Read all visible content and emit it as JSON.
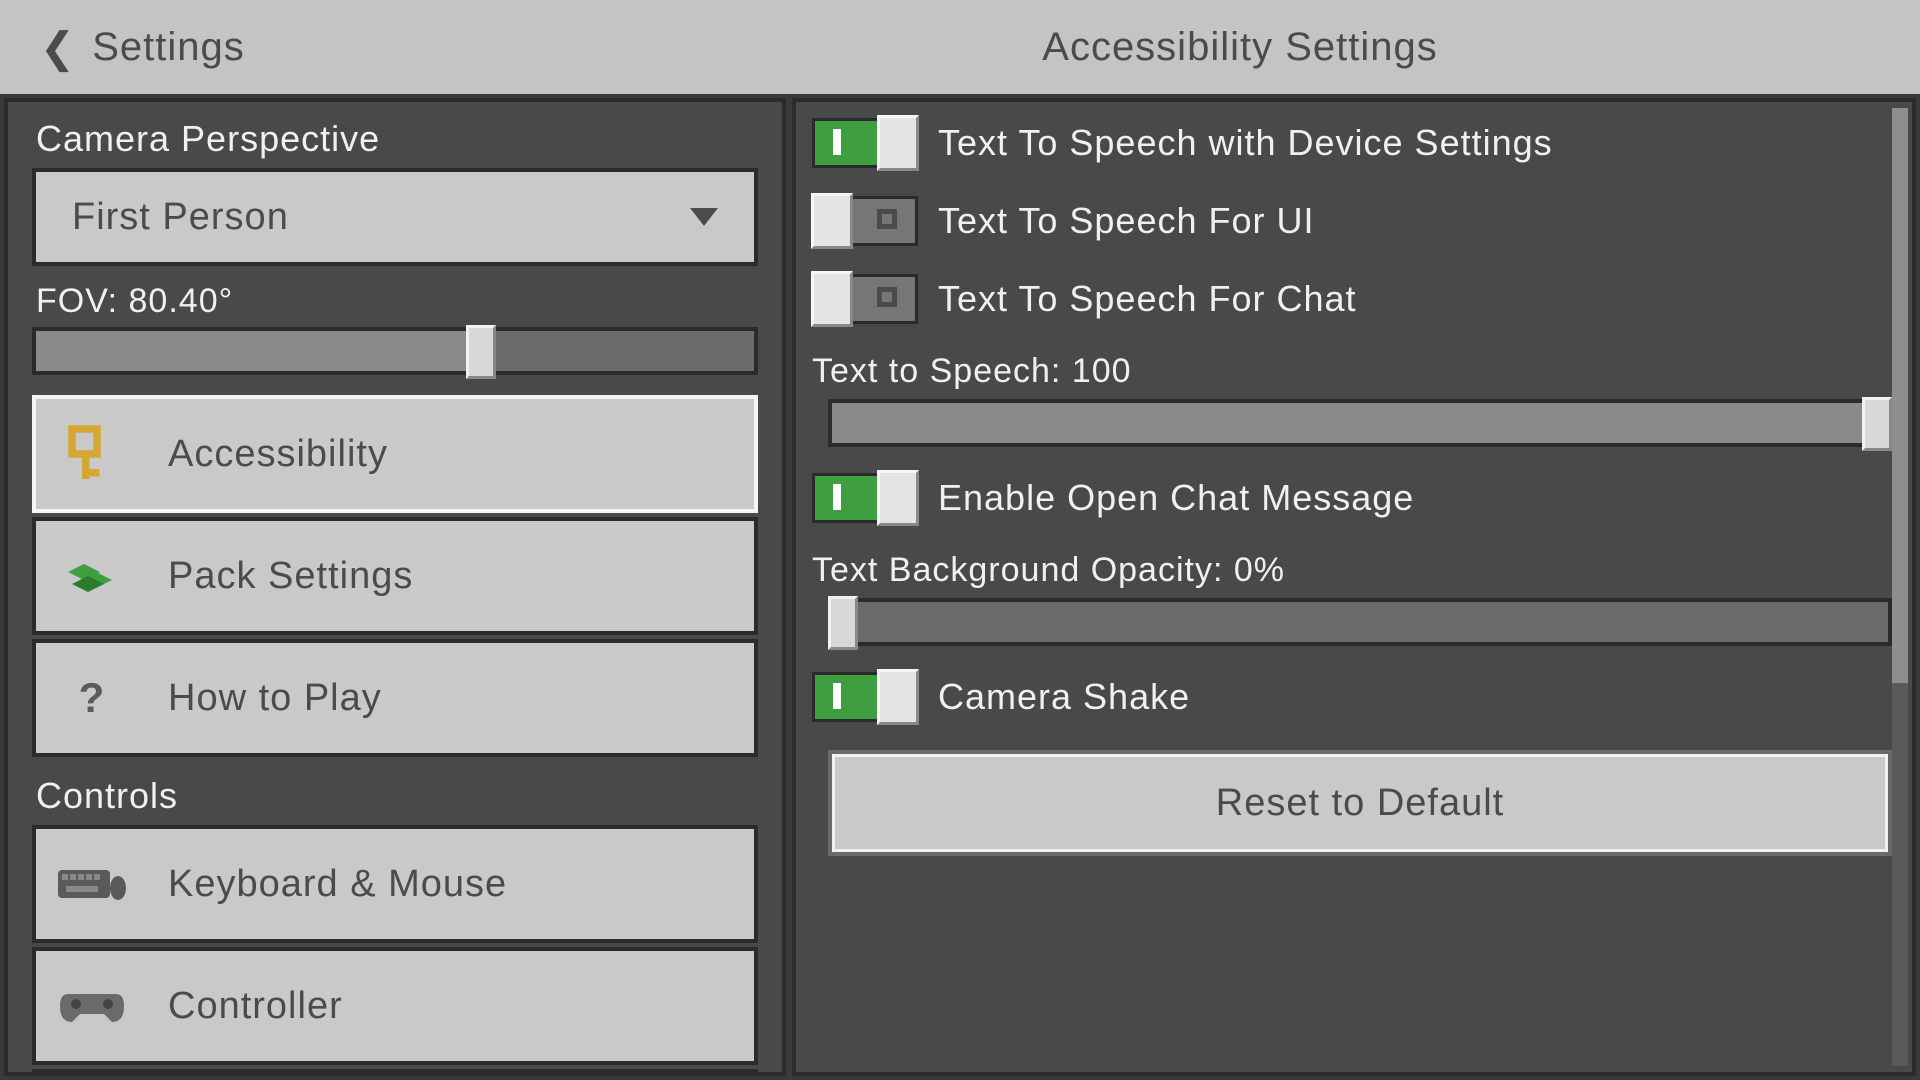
{
  "header": {
    "back_label": "Settings",
    "title": "Accessibility Settings"
  },
  "sidebar": {
    "camera_section": "Camera Perspective",
    "camera_value": "First Person",
    "fov_label": "FOV: 80.40°",
    "fov_percent": 62,
    "nav": [
      {
        "label": "Accessibility",
        "icon": "key",
        "selected": true
      },
      {
        "label": "Pack Settings",
        "icon": "pack",
        "selected": false
      },
      {
        "label": "How to Play",
        "icon": "question",
        "selected": false
      }
    ],
    "controls_section": "Controls",
    "controls": [
      {
        "label": "Keyboard & Mouse",
        "icon": "keyboard"
      },
      {
        "label": "Controller",
        "icon": "controller"
      }
    ]
  },
  "main": {
    "toggles": {
      "tts_device": {
        "label": "Text To Speech with Device Settings",
        "on": true
      },
      "tts_ui": {
        "label": "Text To Speech For UI",
        "on": false
      },
      "tts_chat": {
        "label": "Text To Speech For Chat",
        "on": false
      },
      "open_chat": {
        "label": "Enable Open Chat Message",
        "on": true
      },
      "camera_shake": {
        "label": "Camera Shake",
        "on": true
      }
    },
    "tts_slider": {
      "label": "Text to Speech: 100",
      "percent": 100
    },
    "bg_opacity": {
      "label": "Text Background Opacity: 0%",
      "percent": 0
    },
    "reset_label": "Reset to Default"
  }
}
